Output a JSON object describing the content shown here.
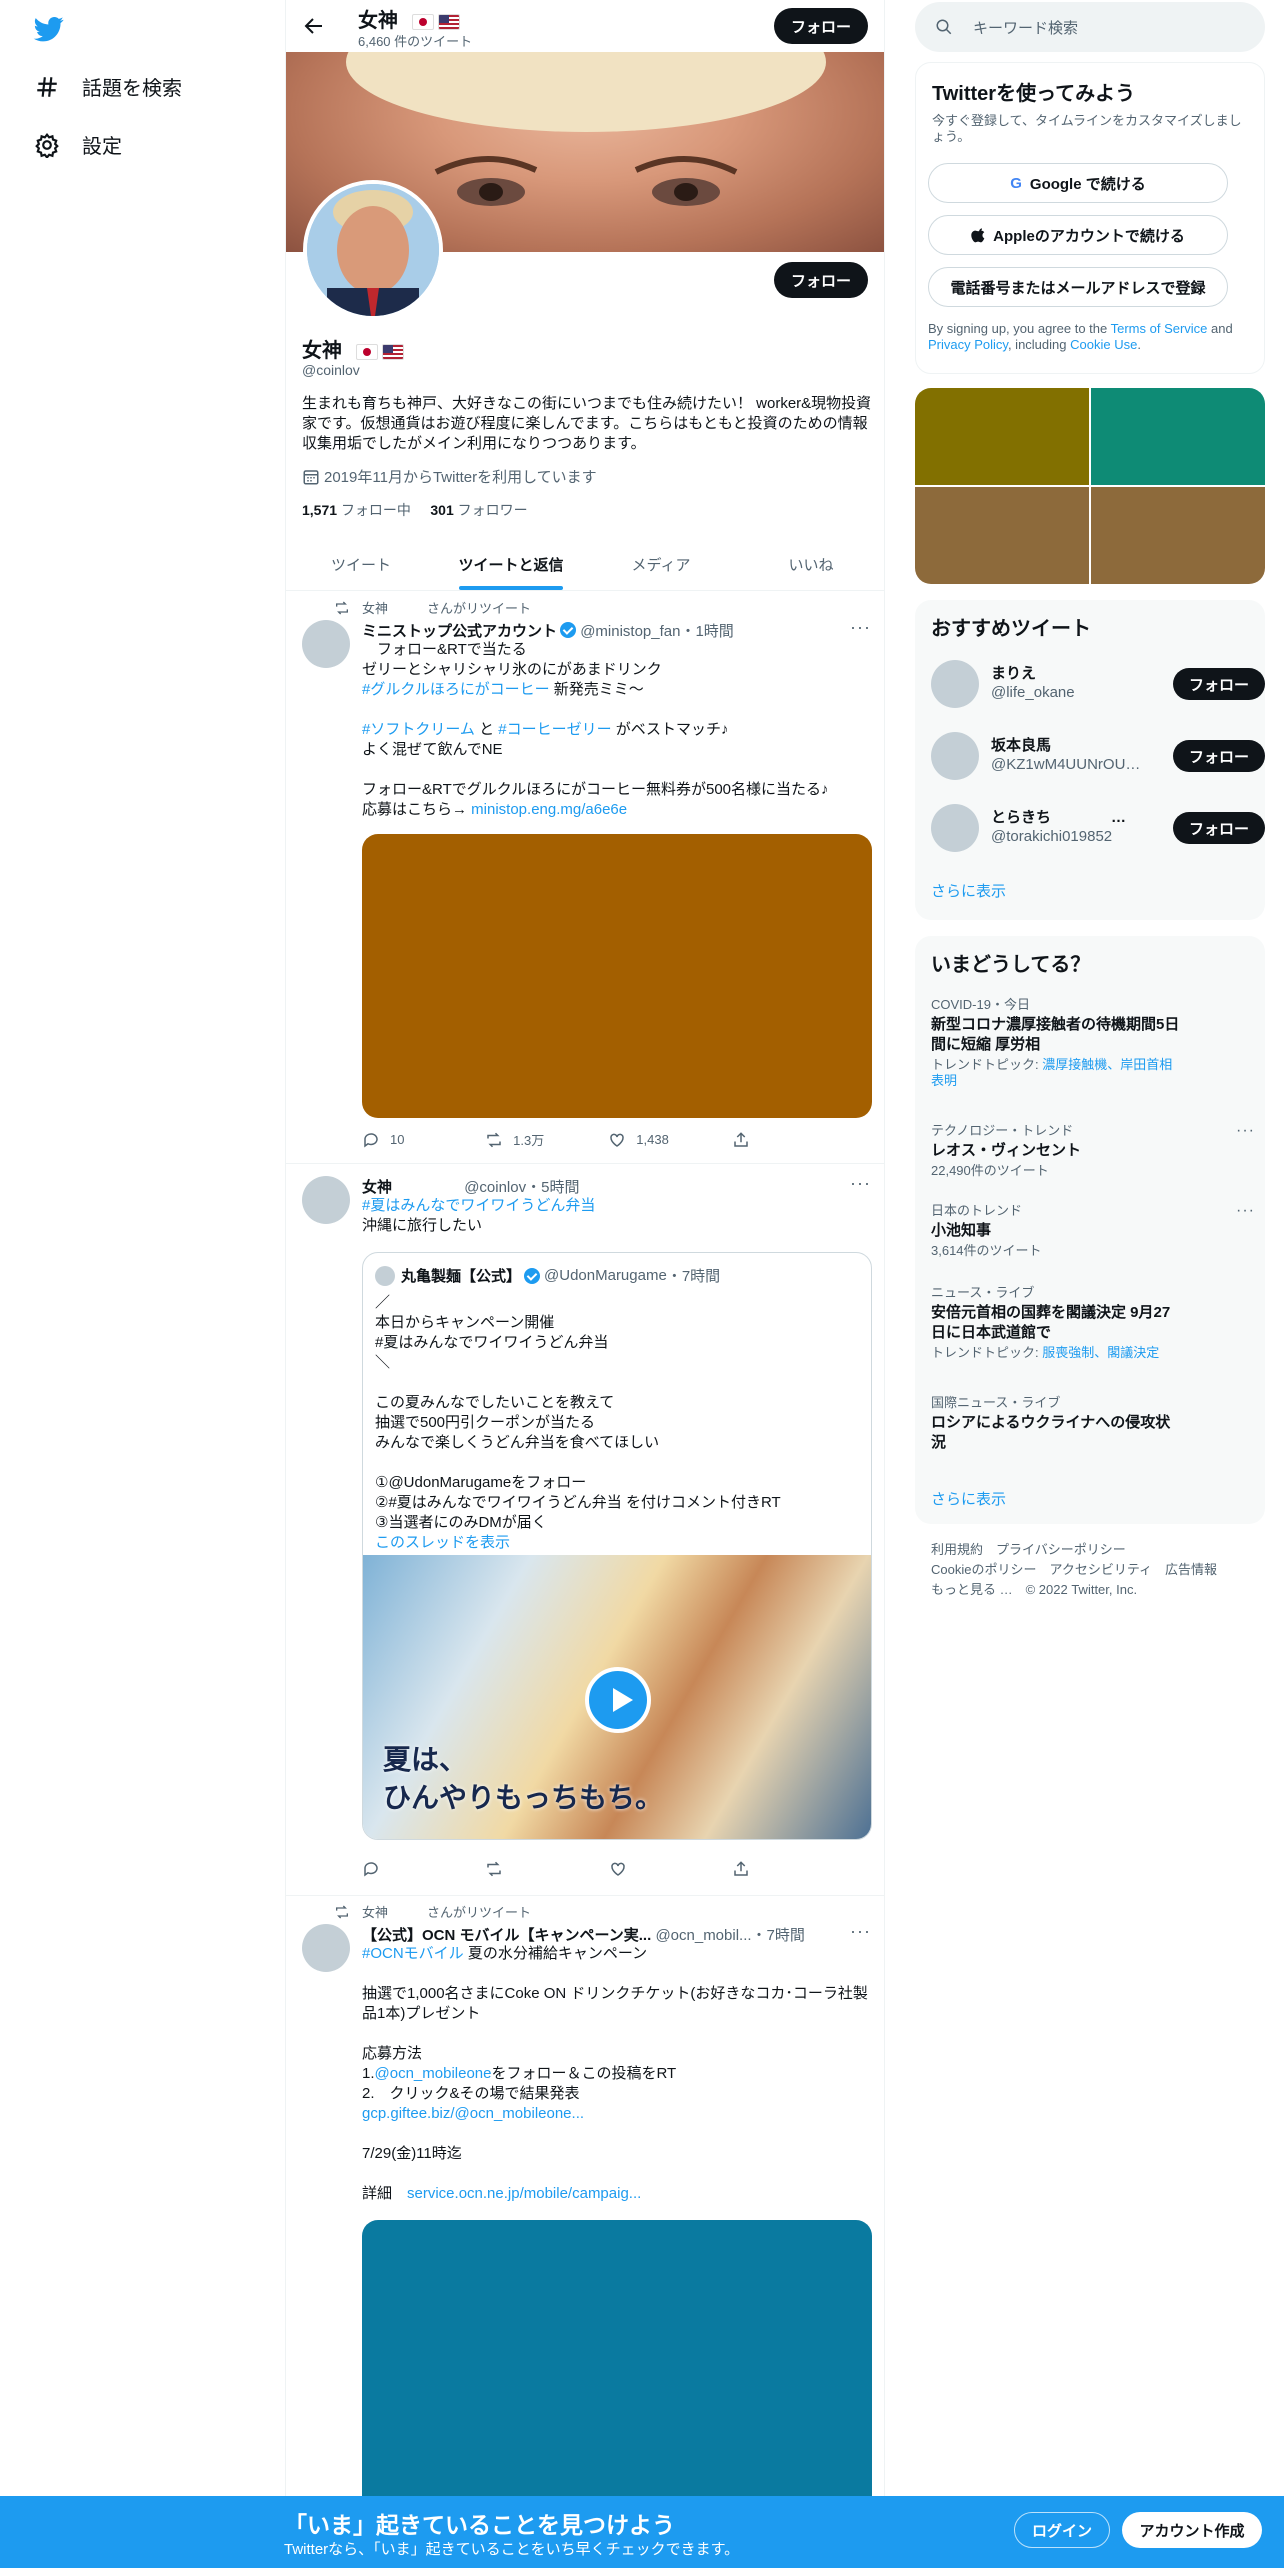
{
  "nav": {
    "explore_label": "話題を検索",
    "settings_label": "設定"
  },
  "header": {
    "name": "女神",
    "tweet_count": "6,460 件のツイート",
    "follow_label": "フォロー"
  },
  "profile": {
    "name": "女神",
    "handle": "@coinlov",
    "bio": "生まれも育ちも神戸、大好きなこの街にいつまでも住み続けたい！ worker&現物投資家です。仮想通貨はお遊び程度に楽しんでます。こちらはもともと投資のための情報収集用垢でしたがメイン利用になりつつあります。",
    "joined": "2019年11月からTwitterを利用しています",
    "following_count": "1,571",
    "following_label": "フォロー中",
    "followers_count": "301",
    "followers_label": "フォロワー",
    "follow_label": "フォロー"
  },
  "tabs": [
    {
      "label": "ツイート"
    },
    {
      "label": "ツイートと返信"
    },
    {
      "label": "メディア"
    },
    {
      "label": "いいね"
    }
  ],
  "tweets": [
    {
      "retweeted_by": "女神　　　さんがリツイート",
      "author": "ミニストップ公式アカウント",
      "handle": "@ministop_fan",
      "time": "・1時間",
      "body_a": "　フォロー&RTで当たる\nゼリーとシャリシャリ氷のにがあまドリンク",
      "hashtag_1": "#グルクルほろにがコーヒー",
      "body_b": " 新発売ミミ～",
      "hashtag_2": "#ソフトクリーム",
      "mid": " と ",
      "hashtag_3": "#コーヒーゼリー",
      "body_c": " がベストマッチ♪\nよく混ぜて飲んでNE",
      "body_d": "フォロー&RTでグルクルほろにがコーヒー無料券が500名様に当たる♪\n応募はこちら→ ",
      "link": "ministop.eng.mg/a6e6e",
      "media_color": "#a35f00",
      "replies": "10",
      "retweets": "1.3万",
      "likes": "1,438"
    },
    {
      "author": "女神",
      "handle": "@coinlov",
      "time": "・5時間",
      "hashtag": "#夏はみんなでワイワイうどん弁当",
      "body": "沖縄に旅行したい",
      "quote": {
        "author": "丸亀製麺【公式】",
        "handle": "@UdonMarugame",
        "time": "・7時間",
        "body": "／\n本日からキャンペーン開催\n#夏はみんなでワイワイうどん弁当\n＼\n\nこの夏みんなでしたいことを教えて\n抽選で500円引クーポンが当たる\nみんなで楽しくうどん弁当を食べてほしい\n\n①@UdonMarugameをフォロー\n②#夏はみんなでワイワイうどん弁当 を付けコメント付きRT\n③当選者にのみDMが届く",
        "thread_link": "このスレッドを表示",
        "image_caption": "夏は、\nひんやりもっちもち。"
      }
    },
    {
      "retweeted_by": "女神　　　さんがリツイート",
      "author": "【公式】OCN モバイル【キャンペーン実...",
      "handle": "@ocn_mobil...",
      "time": "・7時間",
      "hashtag": "#OCNモバイル",
      "body_a": " 夏の水分補給キャンペーン",
      "body_b": "抽選で1,000名さまにCoke ON ドリンクチケット(お好きなコカ･コーラ社製品1本)プレゼント",
      "body_c": "応募方法",
      "step1_prefix": "1.",
      "step1_link": "@ocn_mobileone",
      "step1_suffix": "をフォロー＆この投稿をRT",
      "step2": "2.　クリック&その場で結果発表",
      "link1": "gcp.giftee.biz/@ocn_mobileone...",
      "deadline": "7/29(金)11時迄",
      "detail_label": "詳細　",
      "link2": "service.ocn.ne.jp/mobile/campaig...",
      "media_color": "#0a7aa0"
    }
  ],
  "right": {
    "search_placeholder": "キーワード検索",
    "signup": {
      "title": "Twitterを使ってみよう",
      "subtitle": "今すぐ登録して、タイムラインをカスタマイズしましょう。",
      "google": "Google で続ける",
      "apple": "Appleのアカウントで続ける",
      "phone": "電話番号またはメールアドレスで登録",
      "terms_a": "By signing up, you agree to the ",
      "terms_link1": "Terms of Service",
      "terms_b": " and ",
      "terms_link2": "Privacy Policy",
      "terms_c": ", including ",
      "terms_link3": "Cookie Use",
      "terms_d": "."
    },
    "grid_colors": [
      "#827000",
      "#0e8b75",
      "#8d6a3b",
      "#8d6a3b"
    ],
    "recommend": {
      "title": "おすすめツイート",
      "items": [
        {
          "name": "まりえ",
          "handle": "@life_okane",
          "button": "フォロー"
        },
        {
          "name": "坂本良馬",
          "handle": "@KZ1wM4UUNrOUj...",
          "button": "フォロー"
        },
        {
          "name": "とらきち　　　　…",
          "handle": "@torakichi019852",
          "button": "フォロー"
        }
      ],
      "more": "さらに表示"
    },
    "trends": {
      "title": "いまどうしてる？",
      "items": [
        {
          "meta": "COVID-19・今日",
          "title": "新型コロナ濃厚接触者の待機期間5日間に短縮 厚労相",
          "extra_label": "トレンドトピック: ",
          "extra_links": "濃厚接触機、岸田首相表明"
        },
        {
          "meta": "テクノロジー・トレンド",
          "title": "レオス・ヴィンセント",
          "extra": "22,490件のツイート"
        },
        {
          "meta": "日本のトレンド",
          "title": "小池知事",
          "extra": "3,614件のツイート"
        },
        {
          "meta": "ニュース・ライブ",
          "title": "安倍元首相の国葬を閣議決定 9月27日に日本武道館で",
          "extra_label": "トレンドトピック: ",
          "extra_links": "服喪強制、閣議決定"
        },
        {
          "meta": "国際ニュース・ライブ",
          "title": "ロシアによるウクライナへの侵攻状況"
        }
      ],
      "more": "さらに表示"
    },
    "footer": {
      "line1": "利用規約　プライバシーポリシー",
      "line2": "Cookieのポリシー　アクセシビリティ　広告情報",
      "line3": "もっと見る …　© 2022 Twitter, Inc."
    }
  },
  "bottom": {
    "headline": "「いま」起きていることを見つけよう",
    "sub": "Twitterなら、「いま」起きていることをいち早くチェックできます。",
    "login": "ログイン",
    "signup": "アカウント作成"
  }
}
